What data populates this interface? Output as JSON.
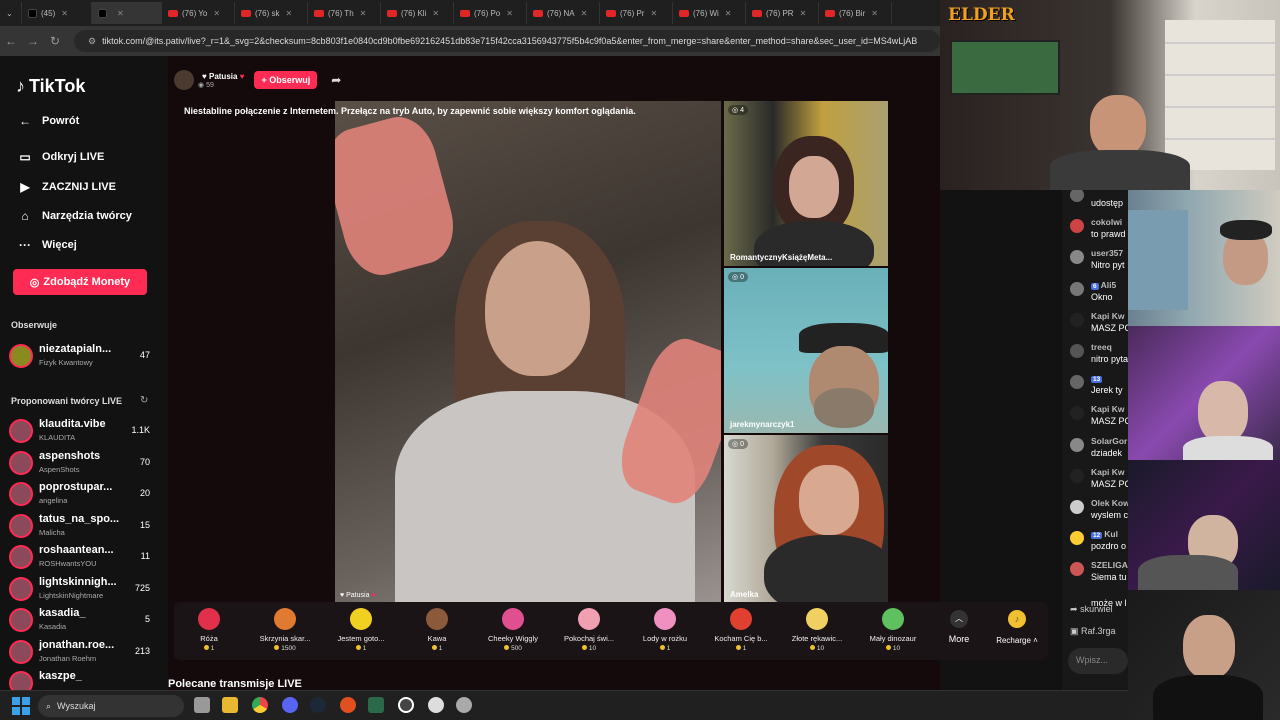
{
  "browser": {
    "tabs": [
      {
        "label": "(45)",
        "kind": "tt"
      },
      {
        "label": "",
        "kind": "tt",
        "active": true
      },
      {
        "label": "(76) Yo",
        "kind": "yt"
      },
      {
        "label": "(76) sk",
        "kind": "yt"
      },
      {
        "label": "(76) Th",
        "kind": "yt"
      },
      {
        "label": "(76) Kli",
        "kind": "yt"
      },
      {
        "label": "(76) Po",
        "kind": "yt"
      },
      {
        "label": "(76) NA",
        "kind": "yt"
      },
      {
        "label": "(76) Pr",
        "kind": "yt"
      },
      {
        "label": "(76) Wi",
        "kind": "yt"
      },
      {
        "label": "(76) PR",
        "kind": "yt"
      },
      {
        "label": "(76) Bir",
        "kind": "yt"
      }
    ],
    "url": "tiktok.com/@its.pativ/live?_r=1&_svg=2&checksum=8cb803f1e0840cd9b0fbe692162451db83e715f42cca3156943775f5b4c9f0a5&enter_from_merge=share&enter_method=share&sec_user_id=MS4wLjAB"
  },
  "sidebar": {
    "logo": "TikTok",
    "back": "Powrót",
    "nav": [
      "Odkryj LIVE",
      "ZACZNIJ LIVE",
      "Narzędzia twórcy",
      "Więcej"
    ],
    "coins_button": "Zdobądź Monety",
    "following_header": "Obserwuje",
    "following": [
      {
        "name": "niezatapialn...",
        "sub": "Fizyk Kwantowy",
        "count": "47"
      }
    ],
    "suggested_header": "Proponowani twórcy LIVE",
    "suggested": [
      {
        "name": "klaudita.vibe",
        "sub": "KLAUDITA",
        "count": "1.1K"
      },
      {
        "name": "aspenshots",
        "sub": "AspenShots",
        "count": "70"
      },
      {
        "name": "poprostupar...",
        "sub": "angelina",
        "count": "20"
      },
      {
        "name": "tatus_na_spo...",
        "sub": "Malicha",
        "count": "15"
      },
      {
        "name": "roshaantean...",
        "sub": "ROSHwantsYOU",
        "count": "11"
      },
      {
        "name": "lightskinnigh...",
        "sub": "LightskinNightmare",
        "count": "725"
      },
      {
        "name": "kasadia_",
        "sub": "Kasadia",
        "count": "5"
      },
      {
        "name": "jonathan.roe...",
        "sub": "Jonathan Roehm",
        "count": "213"
      },
      {
        "name": "kaszpe_",
        "sub": "",
        "count": ""
      }
    ]
  },
  "live": {
    "host_name": "Patusia",
    "viewers": "59",
    "follow_label": "+ Obserwuj",
    "banner": "Niestabline połączenie z Internetem. Przełącz na tryb Auto, by zapewnić sobie większy komfort oglądania.",
    "host_label": "Patusia",
    "guests": [
      {
        "name": "RomantycznyKsiążęMeta...",
        "score": "4"
      },
      {
        "name": "jarekmynarczyk1",
        "score": "0"
      },
      {
        "name": "Amelka",
        "score": "0"
      }
    ],
    "gifts": [
      {
        "label": "Róża",
        "cost": "1",
        "color": "#e0304a"
      },
      {
        "label": "Skrzynia skar...",
        "cost": "1500",
        "color": "#e07a30"
      },
      {
        "label": "Jestem goto...",
        "cost": "1",
        "color": "#f0d020"
      },
      {
        "label": "Kawa",
        "cost": "1",
        "color": "#8a5a3a"
      },
      {
        "label": "Cheeky Wiggly",
        "cost": "500",
        "color": "#e05090"
      },
      {
        "label": "Pokochaj świ...",
        "cost": "10",
        "color": "#f0a0b0"
      },
      {
        "label": "Lody w rożku",
        "cost": "1",
        "color": "#f090c0"
      },
      {
        "label": "Kocham Cię b...",
        "cost": "1",
        "color": "#e04030"
      },
      {
        "label": "Złote rękawic...",
        "cost": "10",
        "color": "#f0d060"
      },
      {
        "label": "Mały dinozaur",
        "cost": "10",
        "color": "#60c060"
      }
    ],
    "more_label": "More",
    "recharge_label": "Recharge",
    "recommended_title": "Polecane transmisje LIVE"
  },
  "chat": {
    "messages": [
      {
        "user": "",
        "text": "udostęp",
        "level": ""
      },
      {
        "user": "cokolwi",
        "text": "to prawd",
        "level": ""
      },
      {
        "user": "user357",
        "text": "Nitro pyt",
        "level": ""
      },
      {
        "user": "Ali5",
        "text": "Okno",
        "level": "6"
      },
      {
        "user": "Kapi Kw",
        "text": "MASZ PC",
        "level": ""
      },
      {
        "user": "treeq",
        "text": "nitro pyta",
        "level": ""
      },
      {
        "user": "",
        "text": "Jerek ty",
        "level": "13"
      },
      {
        "user": "Kapi Kw",
        "text": "MASZ PC",
        "level": ""
      },
      {
        "user": "SolarGor",
        "text": "dziadek",
        "level": ""
      },
      {
        "user": "Kapi Kw",
        "text": "MASZ PC",
        "level": ""
      },
      {
        "user": "Olek Kow",
        "text": "wyslem c",
        "level": ""
      },
      {
        "user": "Kul",
        "text": "pozdro o",
        "level": "12"
      },
      {
        "user": "SZELIGA",
        "text": "Siema tu",
        "level": ""
      }
    ],
    "extra_line": "może w l",
    "footer": [
      "skurwiel",
      "Raf.3rga"
    ],
    "input_placeholder": "Wpisz..."
  },
  "overlay": {
    "streamer_logo": "ELDER"
  },
  "taskbar": {
    "search_label": "Wyszukaj"
  }
}
